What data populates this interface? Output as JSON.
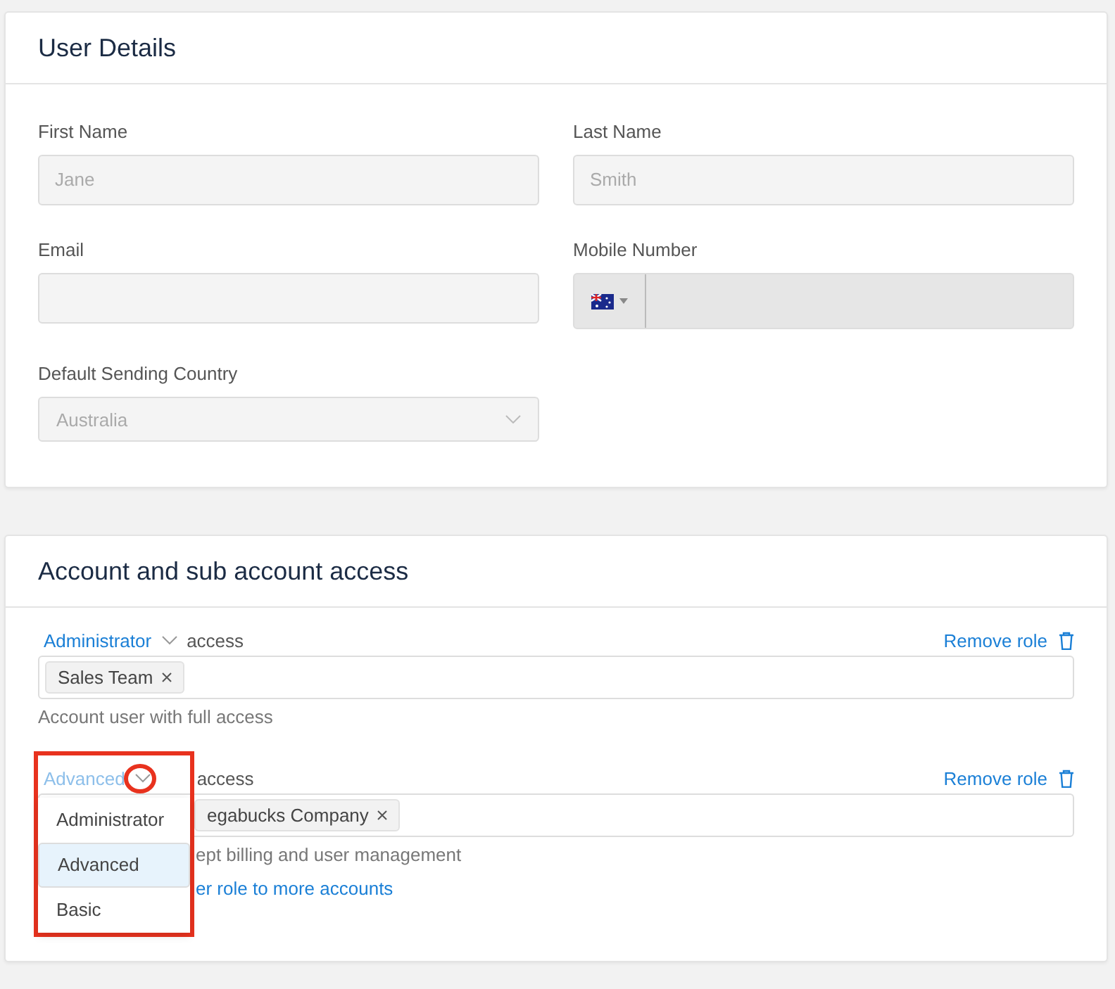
{
  "user_details": {
    "title": "User Details",
    "fields": [
      {
        "kind": "text",
        "label": "First Name",
        "placeholder": "Jane"
      },
      {
        "kind": "text",
        "label": "Last Name",
        "placeholder": "Smith"
      },
      {
        "kind": "text",
        "label": "Email"
      },
      {
        "kind": "phone",
        "label": "Mobile Number"
      },
      {
        "kind": "select",
        "label": "Default Sending Country",
        "value": "Australia"
      }
    ]
  },
  "account_access": {
    "title": "Account and sub account access",
    "roles": [
      {
        "role": "Administrator",
        "suffix": "access",
        "remove": "Remove role",
        "tags": [
          "Sales Team"
        ],
        "description": "Account user with full access",
        "menu_open": false
      },
      {
        "role": "Advanced",
        "suffix": "access",
        "remove": "Remove role",
        "tags": [
          "egabucks Company"
        ],
        "description": "ept billing and user management",
        "link": "er role to more accounts",
        "menu_open": true
      }
    ],
    "menu": [
      {
        "label": "Administrator",
        "selected": false
      },
      {
        "label": "Advanced",
        "selected": true
      },
      {
        "label": "Basic",
        "selected": false
      }
    ]
  }
}
